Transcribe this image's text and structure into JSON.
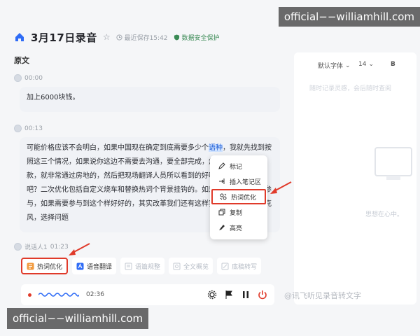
{
  "header": {
    "title": "3月17日录音",
    "save_status": "最近保存15:42",
    "safe_label": "数据安全保护"
  },
  "transcript": {
    "section_label": "原文",
    "entries": [
      {
        "time": "00:00",
        "text": "加上6000块钱。"
      },
      {
        "time": "00:13",
        "text_before": "可能价格应该不会明白，如果中国现在确定到底需要多少个",
        "highlight": "语种",
        "text_after": "，我就先找到按照这三个情况，如果说你这边不需要去沟通，要全部完成，然后咱们方式去借款，就非常通过房地的，然后把现场翻译人员所以看到的好吧，我们老百姓好吧？二次优化包括自定义烧车和替换热词个背景挂钩的。如果需要参与到人家参与，如果需要参与到这个样好好的，其实改革我们还有这样我看了我们选择麦克风，选择问题"
      }
    ],
    "speaker_label": "说话人1",
    "speaker_time": "01:23"
  },
  "context_menu": {
    "items": [
      {
        "label": "标记",
        "icon": "pen-icon"
      },
      {
        "label": "插入笔记区",
        "icon": "insert-icon"
      },
      {
        "label": "热词优化",
        "icon": "hotword-icon",
        "selected": true
      },
      {
        "label": "复制",
        "icon": "copy-icon"
      },
      {
        "label": "高亮",
        "icon": "highlight-icon"
      }
    ]
  },
  "toolbar": {
    "items": [
      {
        "label": "热词优化",
        "state": "active"
      },
      {
        "label": "语音翻译",
        "state": "enabled"
      },
      {
        "label": "语篇规整",
        "state": "disabled"
      },
      {
        "label": "全文概览",
        "state": "disabled"
      },
      {
        "label": "底稿转写",
        "state": "disabled"
      }
    ]
  },
  "player": {
    "time": "02:36"
  },
  "editor": {
    "font_label": "默认字体",
    "size_label": "14",
    "bold_label": "B",
    "placeholder": "随时记录灵感，会后随时查阅",
    "empty_hint": "思想在心中。"
  },
  "watermarks": {
    "top": "official−−williamhill.com",
    "bottom": "official−−williamhill.com",
    "credit": "@讯飞听见录音转文字"
  },
  "colors": {
    "accent_red": "#e03a2a",
    "highlight_blue": "#1f5fd6",
    "brand_blue": "#2f6cf6"
  }
}
